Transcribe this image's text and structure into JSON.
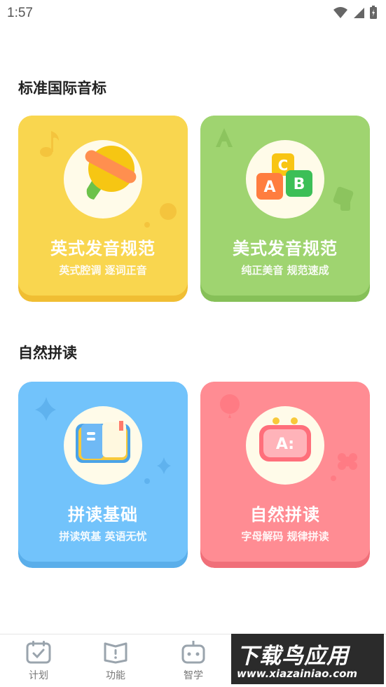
{
  "status_bar": {
    "time": "1:57"
  },
  "sections": [
    {
      "title": "标准国际音标"
    },
    {
      "title": "自然拼读"
    }
  ],
  "cards": [
    {
      "title": "英式发音规范",
      "subtitle": "英式腔调 逐词正音",
      "icon": "bell-icon",
      "color": "#f9d64f"
    },
    {
      "title": "美式发音规范",
      "subtitle": "纯正美音 规范速成",
      "icon": "abc-blocks-icon",
      "color": "#9fd470"
    },
    {
      "title": "拼读基础",
      "subtitle": "拼读筑基 英语无忧",
      "icon": "book-icon",
      "color": "#72c3fb"
    },
    {
      "title": "自然拼读",
      "subtitle": "字母解码 规律拼读",
      "icon": "letter-a-robot-icon",
      "color": "#ff8c93"
    }
  ],
  "tabs": [
    {
      "label": "计划",
      "icon": "calendar-check-icon"
    },
    {
      "label": "功能",
      "icon": "book-open-icon"
    },
    {
      "label": "智学",
      "icon": "robot-icon"
    },
    {
      "label": "",
      "icon": "profile-icon"
    }
  ],
  "watermark": {
    "main": "下载鸟应用",
    "url": "www.xiazainiao.com"
  }
}
